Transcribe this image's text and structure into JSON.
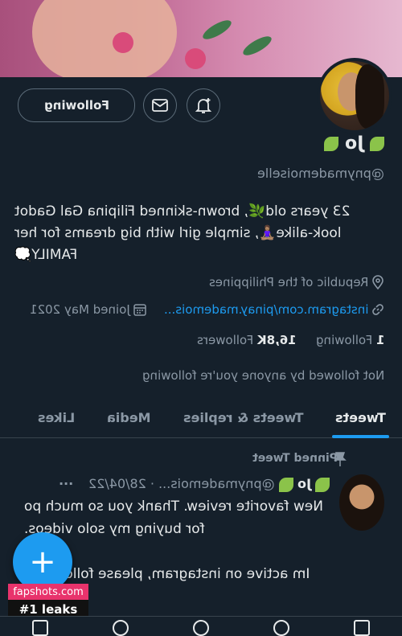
{
  "profile": {
    "name": "Jo",
    "handle": "@pnymademoiselle",
    "bio": "23 years old🌿, brown-skinned Filipina Gal Gadot look-alike🧘🏽‍♀️, simple girl with big dreams for her FAMILY💭",
    "location": "Republic of the Philippines",
    "website": "instagram.com/pinay.mademois...",
    "joined": "Joined May 2021",
    "following_count": "1",
    "following_label": "Following",
    "followers_count": "16,8K",
    "followers_label": "Followers",
    "followed_by": "Not followed by anyone you're following"
  },
  "actions": {
    "follow_label": "Following",
    "message_icon": "mail-icon",
    "notify_icon": "bell-plus-icon"
  },
  "tabs": [
    {
      "label": "Tweets"
    },
    {
      "label": "Tweets & replies"
    },
    {
      "label": "Media"
    },
    {
      "label": "Likes"
    }
  ],
  "pinned": {
    "label": "Pinned Tweet",
    "author": "Jo",
    "handle": "@pnymademois...",
    "date": "· 28/04/22",
    "more": "···",
    "text_1": "New favorite review. Thank you so much po for buying my solo videos.",
    "text_2": "Im active on instagram, please follo there too🥰"
  },
  "fab": {
    "label": "+"
  },
  "watermark": {
    "line1": "fapshots.com",
    "line2": "#1 leaks"
  },
  "colors": {
    "accent": "#1d9bf0",
    "background": "#15202b",
    "watermark_pink": "#e8336c"
  }
}
